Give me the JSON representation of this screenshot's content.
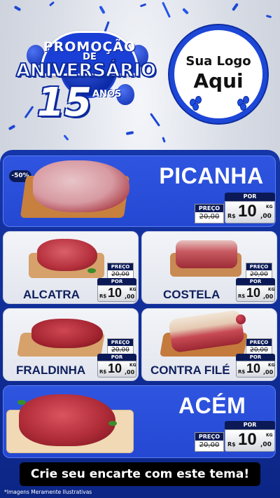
{
  "header": {
    "promo_word": "PROMOÇÃO",
    "de_word": "DE",
    "aniversario_word": "ANIVERSÁRIO",
    "number": "15",
    "anos_word": "ANOS",
    "logo_line1": "Sua Logo",
    "logo_line2": "Aqui"
  },
  "labels": {
    "preco": "PREÇO",
    "por": "POR",
    "currency": "R$",
    "unit": "KG"
  },
  "products": [
    {
      "name": "PICANHA",
      "discount_badge": "-50%",
      "old_price": "20,00",
      "price_int": "10",
      "price_cents": ",00"
    },
    {
      "name": "ALCATRA",
      "old_price": "20,00",
      "price_int": "10",
      "price_cents": ",00"
    },
    {
      "name": "COSTELA",
      "old_price": "20,00",
      "price_int": "10",
      "price_cents": ",00"
    },
    {
      "name": "FRALDINHA",
      "old_price": "20,00",
      "price_int": "10",
      "price_cents": ",00"
    },
    {
      "name": "CONTRA FILÉ",
      "old_price": "20,00",
      "price_int": "10",
      "price_cents": ",00"
    },
    {
      "name": "ACÉM",
      "old_price": "20,00",
      "price_int": "10",
      "price_cents": ",00"
    }
  ],
  "footer": {
    "cta": "Crie seu encarte com este tema!",
    "disclaimer": "*Imagens Meramente Ilustrativas"
  },
  "colors": {
    "brand_blue": "#1d47d6",
    "dark_navy": "#0b1a56",
    "panel_blue": "#1536a8"
  }
}
